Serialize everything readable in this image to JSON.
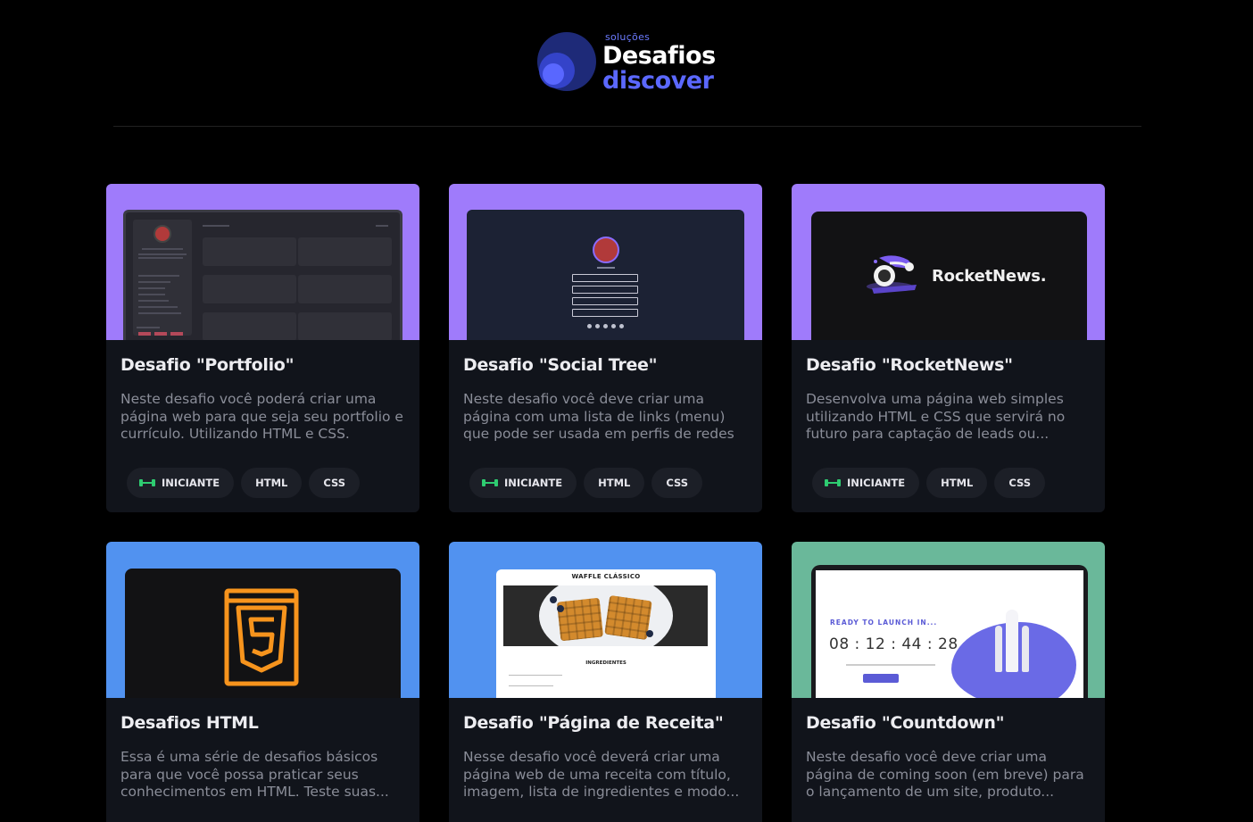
{
  "header": {
    "logo_small": "soluções",
    "logo_title": "Desafios",
    "logo_subtitle": "discover"
  },
  "colors": {
    "accent_purple": "#9f7bfb",
    "accent_blue": "#5192f0",
    "accent_green": "#6ab89a",
    "level_icon": "#2ecc71"
  },
  "cards": [
    {
      "title": "Desafio \"Portfolio\"",
      "description": "Neste desafio você poderá criar uma página web para que seja seu portfolio e currículo. Utilizando HTML e CSS.",
      "level": "INICIANTE",
      "tags": [
        "HTML",
        "CSS"
      ],
      "thumb_bg": "#9f7bfb"
    },
    {
      "title": "Desafio \"Social Tree\"",
      "description": "Neste desafio você deve criar uma página com uma lista de links (menu) que pode ser usada em perfis de redes sociais.",
      "level": "INICIANTE",
      "tags": [
        "HTML",
        "CSS"
      ],
      "thumb_bg": "#9f7bfb"
    },
    {
      "title": "Desafio \"RocketNews\"",
      "description": "Desenvolva uma página web simples utilizando HTML e CSS que servirá no futuro para captação de leads ou...",
      "level": "INICIANTE",
      "tags": [
        "HTML",
        "CSS"
      ],
      "thumb_bg": "#9f7bfb",
      "thumb_text": "RocketNews."
    },
    {
      "title": "Desafios HTML",
      "description": "Essa é uma série de desafios básicos para que você possa praticar seus conhecimentos em HTML. Teste suas...",
      "thumb_bg": "#5192f0"
    },
    {
      "title": "Desafio \"Página de Receita\"",
      "description": "Nesse desafio você deverá criar uma página web de uma receita com título, imagem, lista de ingredientes e modo...",
      "thumb_bg": "#5192f0",
      "thumb_title": "WAFFLE CLÁSSICO",
      "thumb_section": "INGREDIENTES"
    },
    {
      "title": "Desafio \"Countdown\"",
      "description": "Neste desafio você deve criar uma página de coming soon (em breve) para o lançamento de um site, produto...",
      "thumb_bg": "#6ab89a",
      "thumb_ready": "READY TO LAUNCH IN...",
      "thumb_time": "08 : 12 : 44 : 28"
    }
  ]
}
